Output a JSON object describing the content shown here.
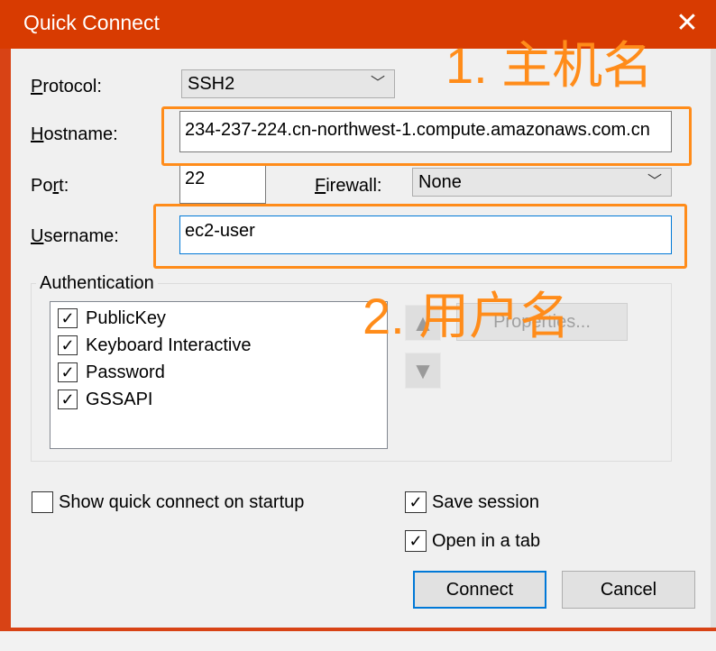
{
  "window": {
    "title": "Quick Connect",
    "close_glyph": "✕"
  },
  "form": {
    "protocol_label": "Protocol:",
    "protocol_value": "SSH2",
    "hostname_label": "Hostname:",
    "hostname_value": "234-237-224.cn-northwest-1.compute.amazonaws.com.cn",
    "port_label": "Port:",
    "port_value": "22",
    "firewall_label": "Firewall:",
    "firewall_value": "None",
    "username_label": "Username:",
    "username_value": "ec2-user"
  },
  "auth": {
    "group_title": "Authentication",
    "methods": [
      {
        "label": "PublicKey",
        "checked": true
      },
      {
        "label": "Keyboard Interactive",
        "checked": true
      },
      {
        "label": "Password",
        "checked": true
      },
      {
        "label": "GSSAPI",
        "checked": true
      }
    ],
    "properties_label": "Properties..."
  },
  "options": {
    "show_on_startup_label": "Show quick connect on startup",
    "show_on_startup_checked": false,
    "save_session_label": "Save session",
    "save_session_checked": true,
    "open_in_tab_label": "Open in a tab",
    "open_in_tab_checked": true
  },
  "buttons": {
    "connect": "Connect",
    "cancel": "Cancel"
  },
  "annotations": {
    "hostname_note": "1. 主机名",
    "username_note": "2. 用户名",
    "color": "#ff8c1a"
  },
  "icons": {
    "dropdown": "chevron-down-icon",
    "close": "close-icon",
    "check": "checkmark-icon"
  },
  "colors": {
    "titlebar": "#d83b01",
    "accent": "#0078d7"
  }
}
